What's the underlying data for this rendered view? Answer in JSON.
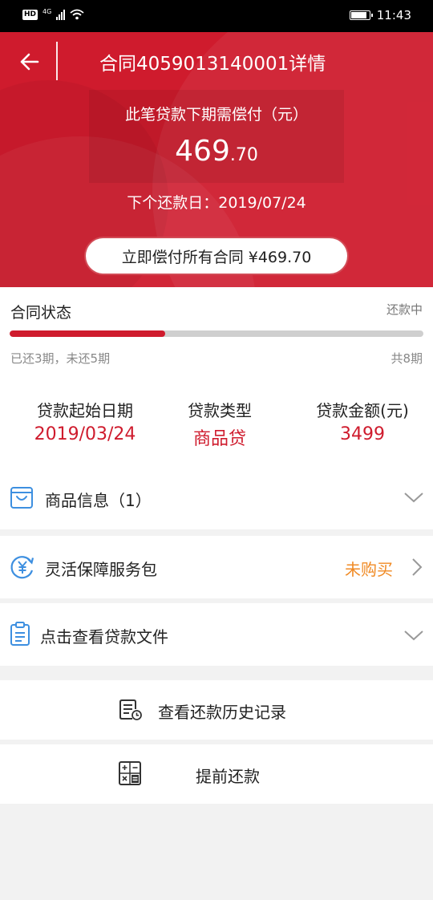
{
  "status_bar": {
    "hd_label": "HD",
    "network_label": "4G",
    "time": "11:43"
  },
  "header": {
    "title": "合同4059013140001详情",
    "subtitle": "此笔贷款下期需偿付（元）",
    "amount_int": "469",
    "amount_dec": ".70",
    "next_due": "下个还款日：2019/07/24",
    "pay_all_label": "立即偿付所有合同 ¥469.70"
  },
  "contract": {
    "status_label": "合同状态",
    "status_value": "还款中",
    "progress_paid_fraction": 0.375,
    "progress_text": "已还3期，未还5期",
    "total_text": "共8期",
    "info": [
      {
        "label": "贷款起始日期",
        "value": "2019/03/24"
      },
      {
        "label": "贷款类型",
        "value": "商品贷"
      },
      {
        "label": "贷款金额(元)",
        "value": "3499"
      }
    ]
  },
  "rows": {
    "goods_info": "商品信息（1）",
    "service_pack": "灵活保障服务包",
    "service_pack_status": "未购买",
    "loan_docs": "点击查看贷款文件",
    "history": "查看还款历史记录",
    "prepay": "提前还款"
  },
  "colors": {
    "brand_red": "#cf1b2d",
    "accent_orange": "#f08a24",
    "icon_blue": "#3d8fe0"
  }
}
